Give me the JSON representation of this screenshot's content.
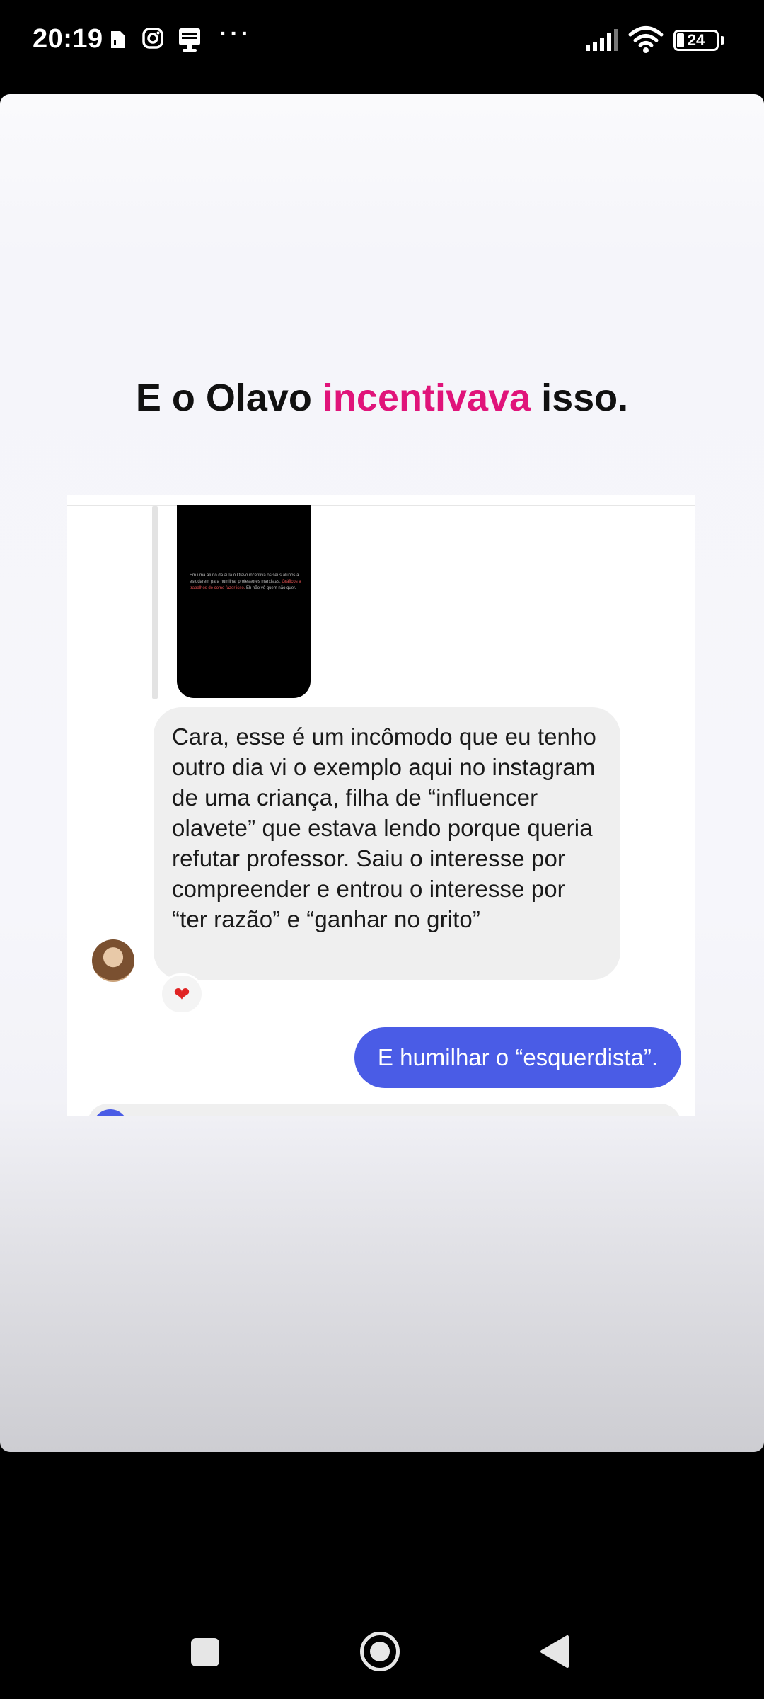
{
  "status_bar": {
    "time": "20:19",
    "battery": "24",
    "icons": [
      "sim-card-icon",
      "instagram-icon",
      "notification-icon",
      "more-dots-icon",
      "signal-icon",
      "wifi-icon",
      "battery-icon"
    ],
    "more": "···"
  },
  "story": {
    "headline_pre": "E o Olavo ",
    "headline_accent": "incentivava",
    "headline_post": " isso.",
    "accent_color": "#e0147a"
  },
  "chat": {
    "quoted_story_text": "Em uma aluno da aula o Olavo incentiva os seus alunos a estudarem para humilhar professores marxistas. ",
    "quoted_story_highlight": "Gráficos a trabalhos de como fazer isso.",
    "quoted_story_tail": " Eh não vê quem não quer.",
    "incoming_message": "Cara, esse é um incômodo que eu tenho outro dia vi o exemplo aqui no instagram de uma criança, filha de “influencer olavete” que estava lendo porque queria refutar professor. Saiu o interesse por compreender e entrou o interesse por “ter razão” e “ganhar no grito”",
    "reaction": "❤",
    "outgoing_message": "E humilhar o “esquerdista”.",
    "outgoing_color": "#4a5ce6"
  },
  "nav_bar": {
    "buttons": [
      "recents-button",
      "home-button",
      "back-button"
    ]
  }
}
